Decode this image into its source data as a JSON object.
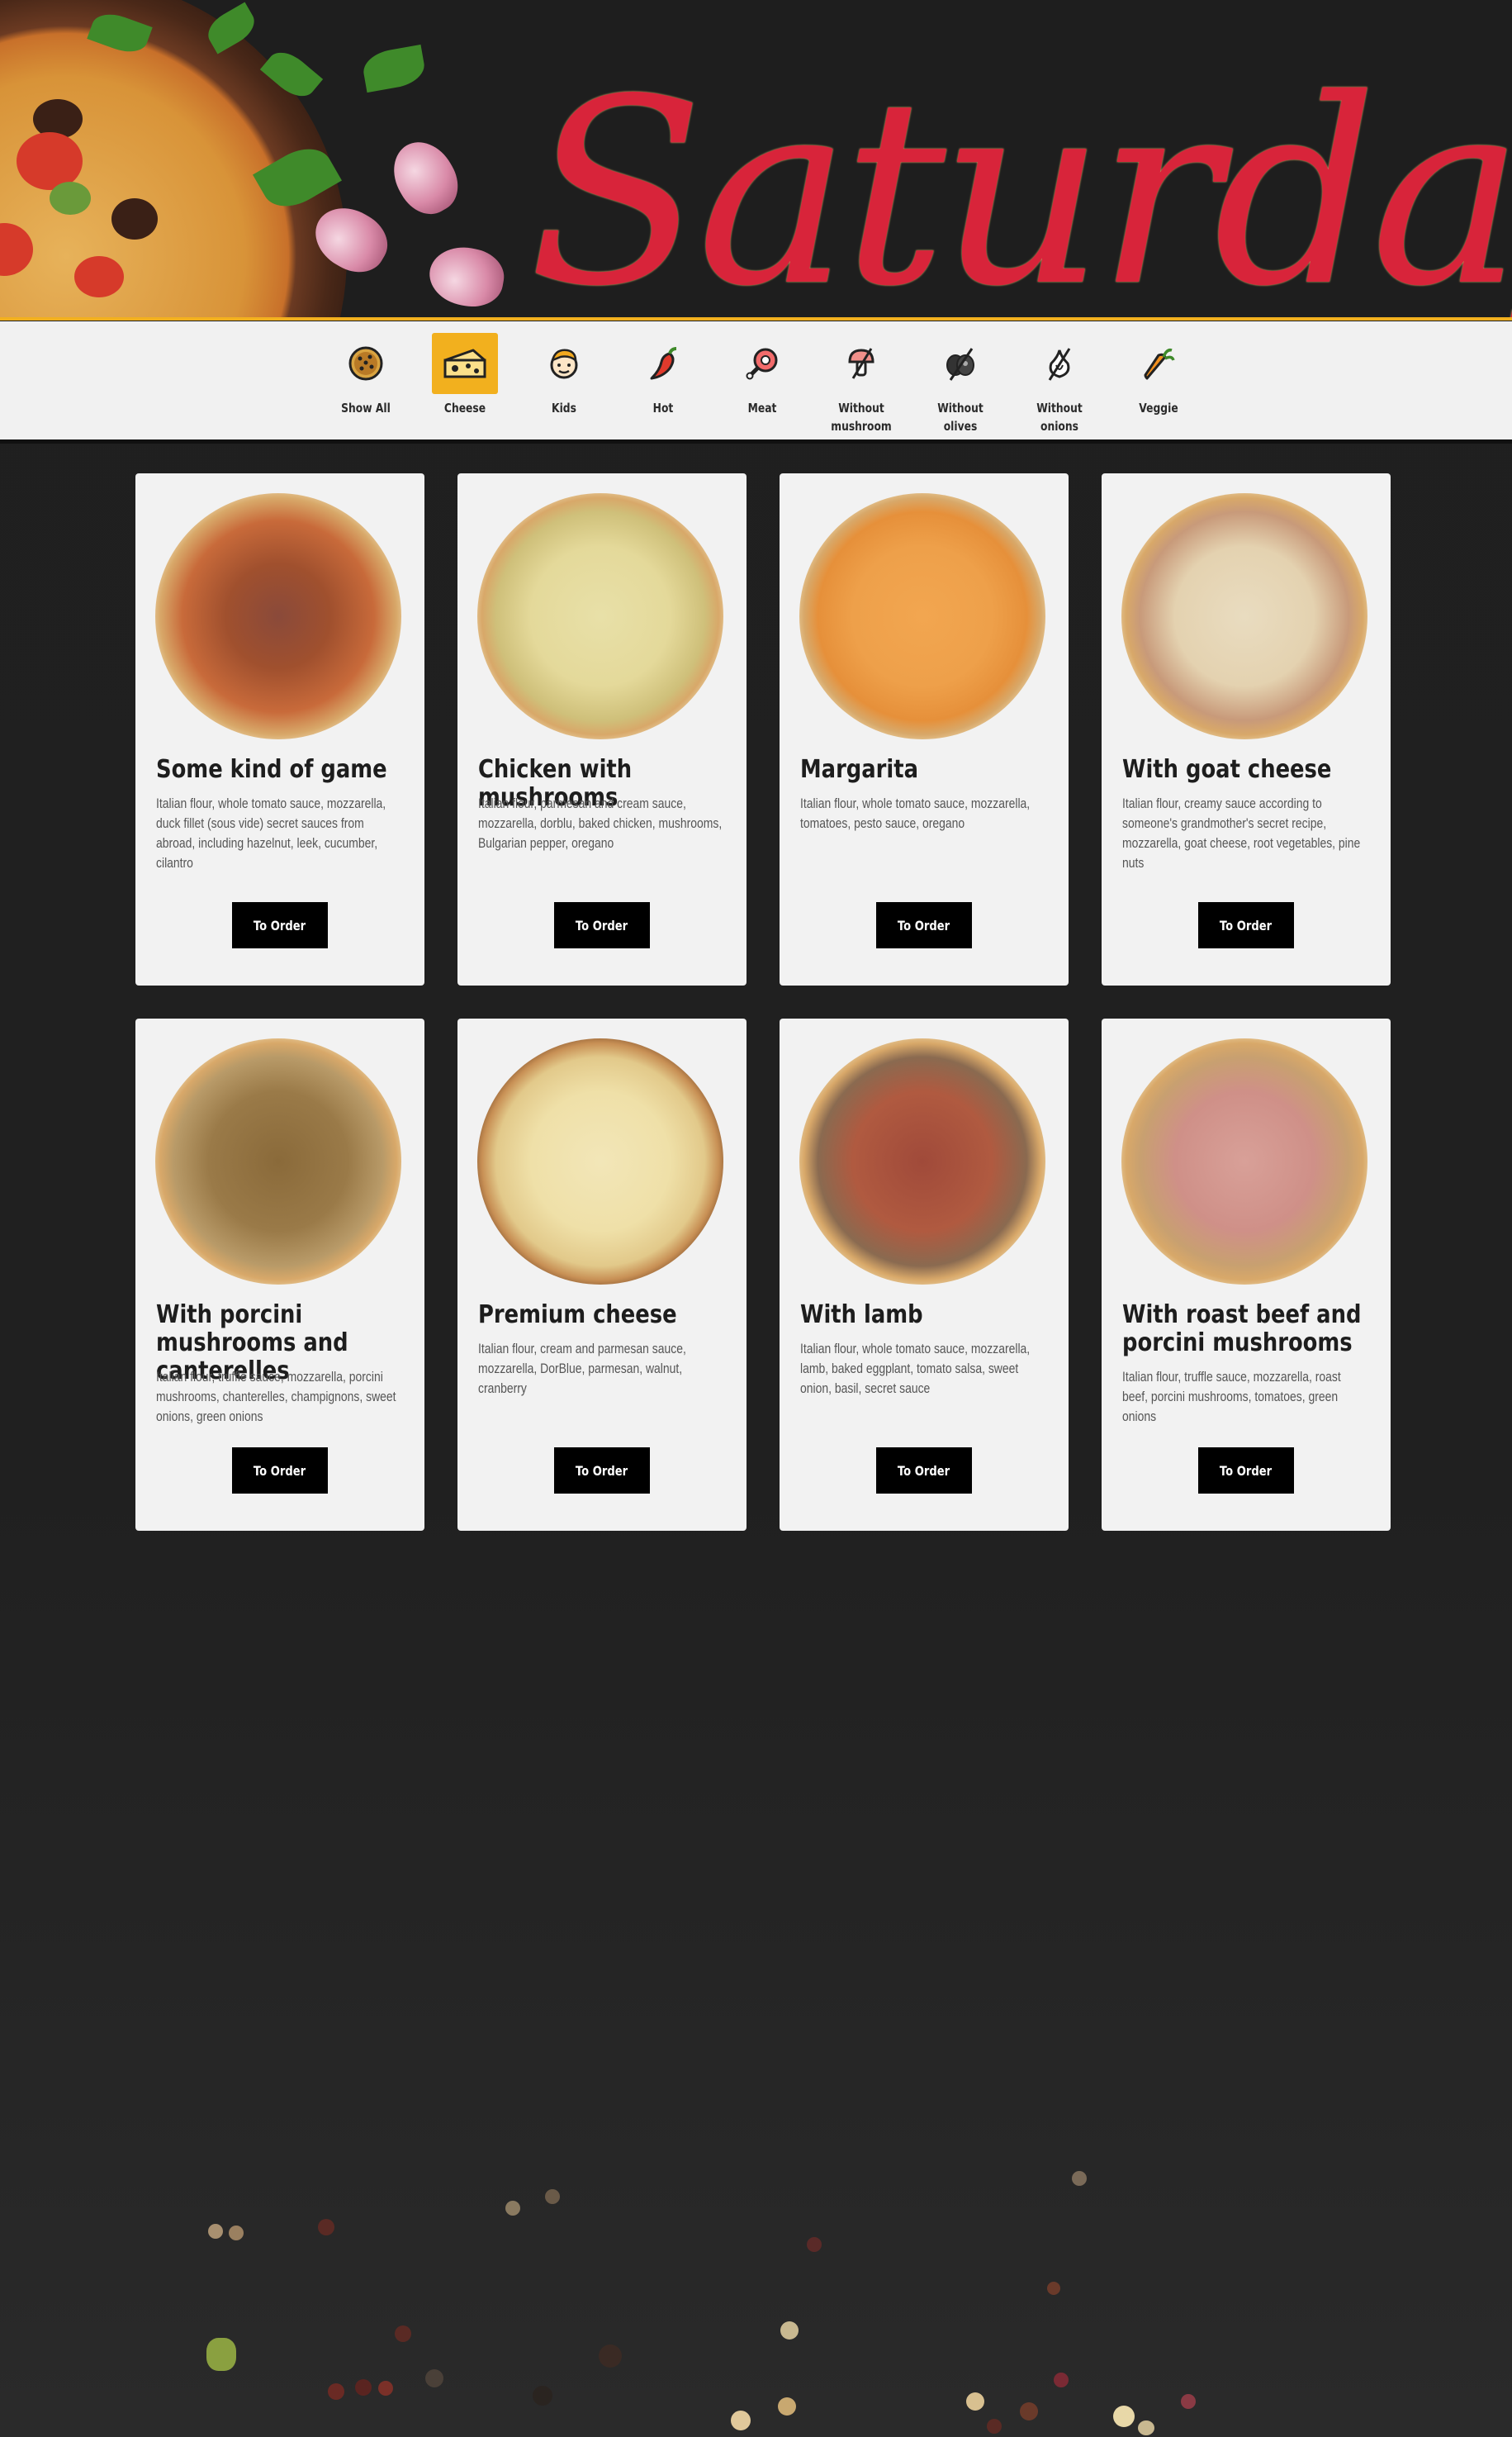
{
  "hero": {
    "title": "Saturdays"
  },
  "colors": {
    "accent": "#f2b01e",
    "title_red": "#d8243a",
    "background": "#1f1f1f",
    "card": "#f2f2f2",
    "button": "#000000"
  },
  "filters": [
    {
      "label": "Show All",
      "icon": "pizza-icon",
      "active": false
    },
    {
      "label": "Cheese",
      "icon": "cheese-icon",
      "active": true
    },
    {
      "label": "Kids",
      "icon": "kid-face-icon",
      "active": false
    },
    {
      "label": "Hot",
      "icon": "chili-pepper-icon",
      "active": false
    },
    {
      "label": "Meat",
      "icon": "ham-leg-icon",
      "active": false
    },
    {
      "label": "Without\nmushroom",
      "icon": "mushroom-crossed-icon",
      "active": false
    },
    {
      "label": "Without\nolives",
      "icon": "olive-crossed-icon",
      "active": false
    },
    {
      "label": "Without\nonions",
      "icon": "onion-crossed-icon",
      "active": false
    },
    {
      "label": "Veggie",
      "icon": "carrot-icon",
      "active": false
    }
  ],
  "products": [
    {
      "title": "Some kind of game",
      "description": "Italian flour, whole tomato sauce, mozzarella, duck fillet (sous vide) secret sauces from abroad, including hazelnut, leek, cucumber, cilantro",
      "button": "To Order"
    },
    {
      "title": "Chicken with mushrooms",
      "description": "Italian flour, parmesan and cream sauce, mozzarella, dorblu, baked chicken, mushrooms, Bulgarian pepper, oregano",
      "button": "To Order"
    },
    {
      "title": "Margarita",
      "description": "Italian flour, whole tomato sauce, mozzarella, tomatoes, pesto sauce, oregano",
      "button": "To Order"
    },
    {
      "title": "With goat cheese",
      "description": "Italian flour, creamy sauce according to someone's grandmother's secret recipe, mozzarella, goat cheese, root vegetables, pine nuts",
      "button": "To Order"
    },
    {
      "title": "With porcini mushrooms and canterelles",
      "description": "Italian flour, truffle sauce, mozzarella, porcini mushrooms, chanterelles, champignons, sweet onions, green onions",
      "button": "To Order"
    },
    {
      "title": "Premium cheese",
      "description": "Italian flour, cream and parmesan sauce, mozzarella, DorBlue, parmesan, walnut, cranberry",
      "button": "To Order"
    },
    {
      "title": "With lamb",
      "description": "Italian flour, whole tomato sauce, mozzarella, lamb, baked eggplant, tomato salsa, sweet onion, basil, secret sauce",
      "button": "To Order"
    },
    {
      "title": "With roast beef and porcini mushrooms",
      "description": "Italian flour, truffle sauce, mozzarella, roast beef, porcini mushrooms, tomatoes, green onions",
      "button": "To Order"
    }
  ]
}
